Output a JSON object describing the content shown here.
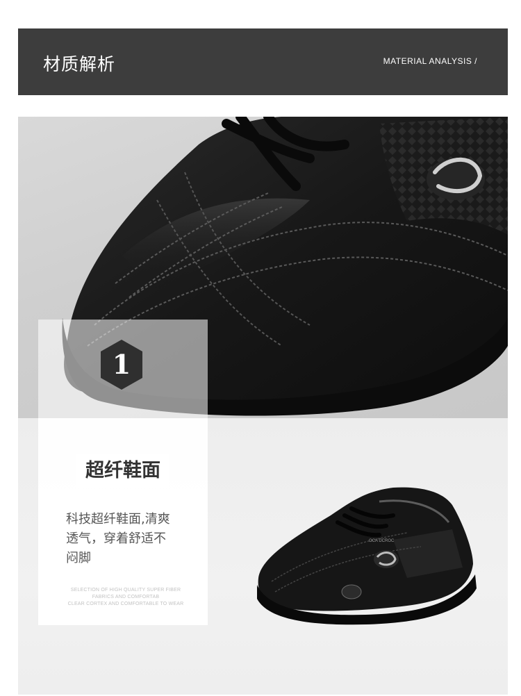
{
  "header": {
    "title": "材质解析",
    "subtitle": "MATERIAL ANALYSIS /"
  },
  "feature": {
    "number": "1",
    "title": "超纤鞋面",
    "description_lines": [
      "科技超纤鞋面,清爽",
      "透气，穿着舒适不",
      "闷脚"
    ],
    "fine_print_lines": [
      "SELECTION OF HIGH QUALITY SUPER FIBER",
      "FABRICS AND COMFORTAB",
      "CLEAR CORTEX AND COMFORTABLE TO WEAR"
    ]
  },
  "shoe_small": {
    "brand_text": "OCA DCROC"
  },
  "colors": {
    "header_bg": "#3d3d3d",
    "shoe_black": "#161616",
    "badge": "#2f2f2f"
  }
}
